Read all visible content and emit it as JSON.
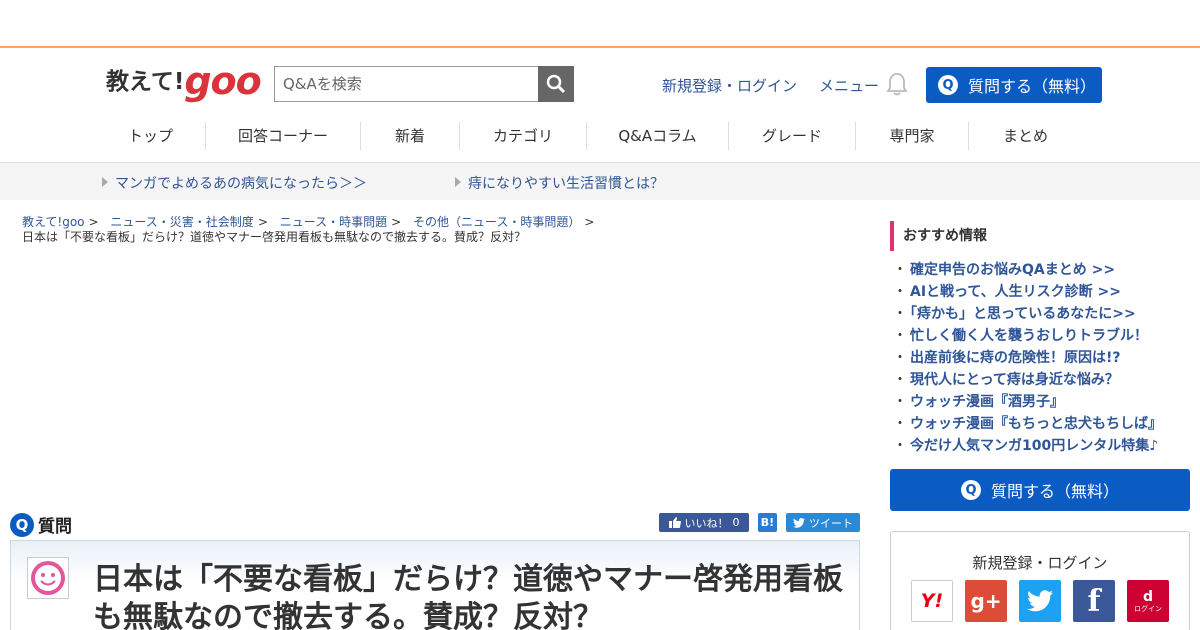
{
  "header": {
    "logo_ja": "教えて!",
    "logo_goo": "goo",
    "search_placeholder": "Q&Aを検索",
    "register_login": "新規登録・ログイン",
    "menu": "メニュー",
    "ask_button": "質問する（無料）",
    "ask_icon": "Q"
  },
  "global_nav": [
    "トップ",
    "回答コーナー",
    "新着",
    "カテゴリ",
    "Q&Aコラム",
    "グレード",
    "専門家",
    "まとめ"
  ],
  "sub_nav": [
    "マンガでよめるあの病気になったら＞＞",
    "痔になりやすい生活習慣とは？"
  ],
  "breadcrumb": {
    "links": [
      "教えて!goo",
      "ニュース・災害・社会制度",
      "ニュース・時事問題",
      "その他（ニュース・時事問題）"
    ],
    "separator": ">",
    "current": "日本は「不要な看板」だらけ？道徳やマナー啓発用看板も無駄なので撤去する。賛成？反対？"
  },
  "question": {
    "section_icon": "Q",
    "section_label": "質問",
    "like_label": "いいね！",
    "like_count": "0",
    "hatena_label": "B!",
    "tweet_label": "ツイート",
    "title": "日本は「不要な看板」だらけ？道徳やマナー啓発用看板も無駄なので撤去する。賛成？反対？"
  },
  "sidebar": {
    "recommend_title": "おすすめ情報",
    "recommend_items": [
      "確定申告のお悩みQAまとめ >>",
      "AIと戦って、人生リスク診断 >>",
      "「痔かも」と思っているあなたに>>",
      "忙しく働く人を襲うおしりトラブル！",
      "出産前後に痔の危険性！原因は!?",
      "現代人にとって痔は身近な悩み？",
      "ウォッチ漫画『酒男子』",
      "ウォッチ漫画『もちっと忠犬もちしば』",
      "今だけ人気マンガ100円レンタル特集♪"
    ],
    "bullet": "・",
    "ask_button": "質問する（無料）",
    "ask_icon": "Q",
    "login_title": "新規登録・ログイン",
    "login_providers": [
      {
        "name": "yahoo",
        "label": "Y!",
        "color": "#ffffff"
      },
      {
        "name": "google-plus",
        "label": "g+",
        "color": "#dd4b39"
      },
      {
        "name": "twitter",
        "label": "",
        "color": "#1da1f2"
      },
      {
        "name": "facebook",
        "label": "f",
        "color": "#3b5998"
      },
      {
        "name": "docomo",
        "label": "d",
        "sublabel": "ログイン",
        "color": "#cc0033"
      }
    ]
  },
  "colors": {
    "accent_orange": "#f4a66b",
    "primary_blue": "#0b5bc4",
    "link_blue": "#2f5597",
    "logo_red": "#d8343b",
    "recommend_pink": "#e2336d"
  }
}
